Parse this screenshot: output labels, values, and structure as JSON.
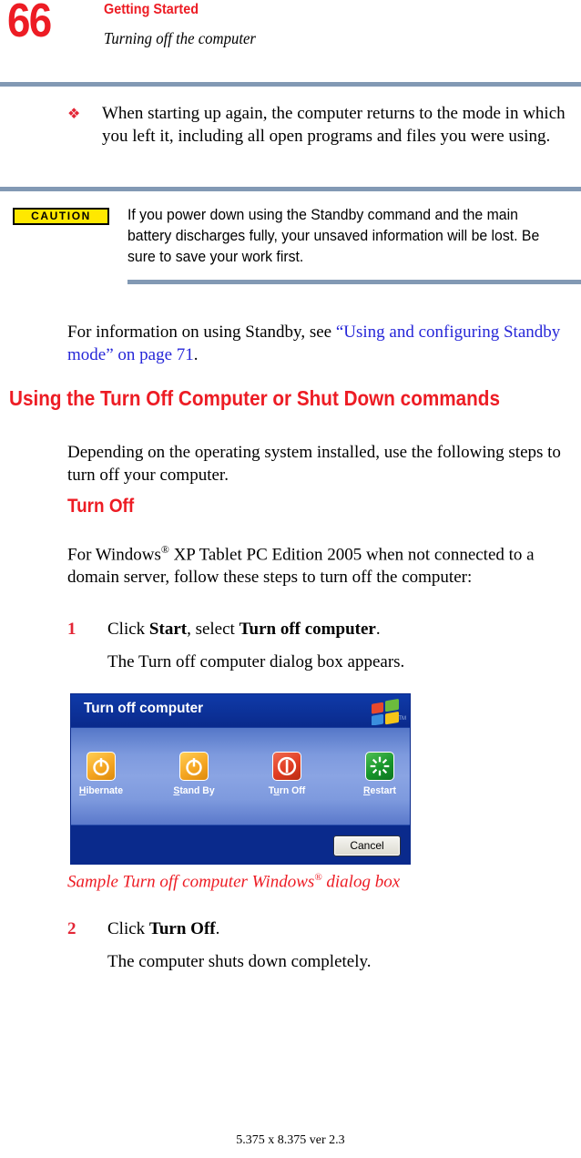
{
  "page": {
    "number": "66",
    "chapter": "Getting Started",
    "section": "Turning off the computer",
    "footer": "5.375 x 8.375 ver 2.3",
    "accent_red": "#ed1c24",
    "rule_color": "#8299b4",
    "link_color": "#2727d8"
  },
  "bullet": {
    "marker": "❖",
    "text": "When starting up again, the computer returns to the mode in which you left it, including all open programs and files you were using."
  },
  "caution": {
    "label": "CAUTION",
    "text": "If you power down using the Standby command and the main battery discharges fully, your unsaved information will be lost. Be sure to save your work first."
  },
  "standby_para": {
    "lead": "For information on using Standby, see ",
    "xref": "“Using and configuring Standby mode” on page 71",
    "tail": "."
  },
  "headings": {
    "h1": "Using the Turn Off Computer or Shut Down commands",
    "h2": "Turn Off"
  },
  "paragraphs": {
    "depending": "Depending on the operating system installed, use the following steps to turn off your computer.",
    "winxp_1": "For Windows",
    "winxp_sup": "®",
    "winxp_2": " XP Tablet PC Edition 2005 when not connected to a domain server, follow these steps to turn off the computer:"
  },
  "steps": [
    {
      "number": "1",
      "text_a": "Click ",
      "bold_a": "Start",
      "text_b": ", select ",
      "bold_b": "Turn off computer",
      "text_c": ".",
      "sub": "The Turn off computer dialog box appears."
    },
    {
      "number": "2",
      "text_a": "Click ",
      "bold_a": "Turn Off",
      "text_b": "",
      "bold_b": "",
      "text_c": ".",
      "sub": "The computer shuts down completely."
    }
  ],
  "figure": {
    "caption_a": "Sample Turn off computer Windows",
    "caption_sup": "®",
    "caption_b": " dialog box"
  },
  "dialog": {
    "title": "Turn off computer",
    "cancel_label": "Cancel",
    "logo_tm": "TM",
    "options": [
      {
        "label_accel": "H",
        "label_rest": "ibernate",
        "icon": "power-standby-icon",
        "color": "#f5a623"
      },
      {
        "label_accel": "S",
        "label_rest": "tand By",
        "icon": "power-standby-icon",
        "color": "#f5a623"
      },
      {
        "label_accel": "u",
        "label_rest": "",
        "label_pre": "T",
        "label_post": "rn Off",
        "icon": "power-off-icon",
        "color": "#e03c22"
      },
      {
        "label_accel": "R",
        "label_rest": "estart",
        "icon": "restart-icon",
        "color": "#17952a"
      }
    ]
  }
}
